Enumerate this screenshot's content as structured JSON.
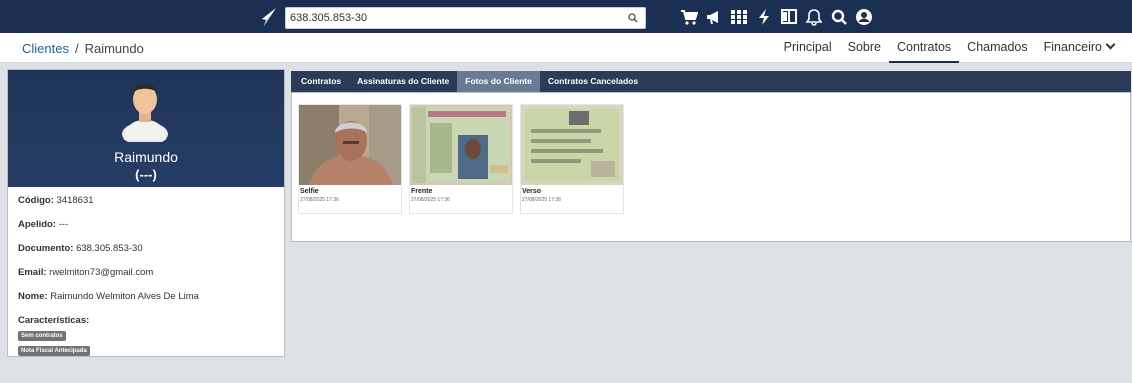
{
  "search": {
    "value": "638.305.853-30"
  },
  "breadcrumb": {
    "parent": "Clientes",
    "current": "Raimundo"
  },
  "nav": {
    "items": [
      "Principal",
      "Sobre",
      "Contratos",
      "Chamados",
      "Financeiro"
    ],
    "active": "Contratos"
  },
  "profile": {
    "name": "Raimundo",
    "nickname": "(---)",
    "fields": {
      "codigo": {
        "label": "Código:",
        "value": "3418631"
      },
      "apelido": {
        "label": "Apelido:",
        "value": "---"
      },
      "documento": {
        "label": "Documento:",
        "value": "638.305.853-30"
      },
      "email": {
        "label": "Email:",
        "value": "rwelmiton73@gmail.com"
      },
      "nome": {
        "label": "Nome:",
        "value": "Raimundo Welmiton Alves De Lima"
      }
    },
    "caracteristicas_label": "Características:",
    "tags": [
      "Sem contratos",
      "Nota Fiscal Antecipada"
    ]
  },
  "tabs": {
    "items": [
      "Contratos",
      "Assinaturas do Cliente",
      "Fotos do Cliente",
      "Contratos Cancelados"
    ],
    "active": "Fotos do Cliente"
  },
  "photos": [
    {
      "caption": "Selfie",
      "date": "27/08/2025 17:36"
    },
    {
      "caption": "Frente",
      "date": "27/08/2025 17:36"
    },
    {
      "caption": "Verso",
      "date": "27/08/2025 17:36"
    }
  ],
  "colors": {
    "topbar": "#1b2f52",
    "tabs": "#2b3c58",
    "active_tab": "#6a7a93",
    "tag": "#737373"
  },
  "icons": [
    "logo-icon",
    "cart-icon",
    "megaphone-icon",
    "grid-icon",
    "bolt-icon",
    "book-icon",
    "bell-icon",
    "search-icon",
    "user-circle-icon"
  ]
}
